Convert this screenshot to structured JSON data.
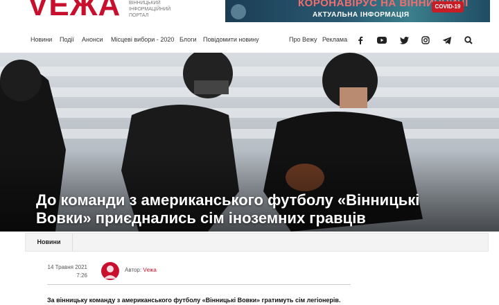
{
  "site": {
    "logo": "VEЖA",
    "logo_subtitle": "Вінницький інформаційний портал"
  },
  "banner": {
    "title": "КОРОНАВІРУС НА ВІННИЧЧИНІ",
    "subtitle": "АКТУАЛЬНА ІНФОРМАЦІЯ",
    "badge": "COVID-19"
  },
  "nav": {
    "items": [
      "Новини",
      "Події",
      "Анонси",
      "Місцеві вибори - 2020",
      "Блоги",
      "Повідомити новину"
    ],
    "right_items": [
      "Про Вежу",
      "Реклама"
    ],
    "social_icons": [
      "facebook-icon",
      "youtube-icon",
      "twitter-icon",
      "instagram-icon",
      "telegram-icon",
      "search-icon"
    ]
  },
  "article": {
    "title": "До команди з американського футболу «Вінницькі Вовки» приєднались сім іноземних гравців",
    "category": "Новини",
    "date": "14 Травня 2021",
    "time": "7:26",
    "author_label": "Автор:",
    "author_name": "Vежа",
    "lead": "За вінницьку команду з американського футболу «Вінницькі Вовки» гратимуть сім легіонерів."
  },
  "colors": {
    "brand": "#c8102e",
    "banner_bg": "#1f4c63"
  }
}
